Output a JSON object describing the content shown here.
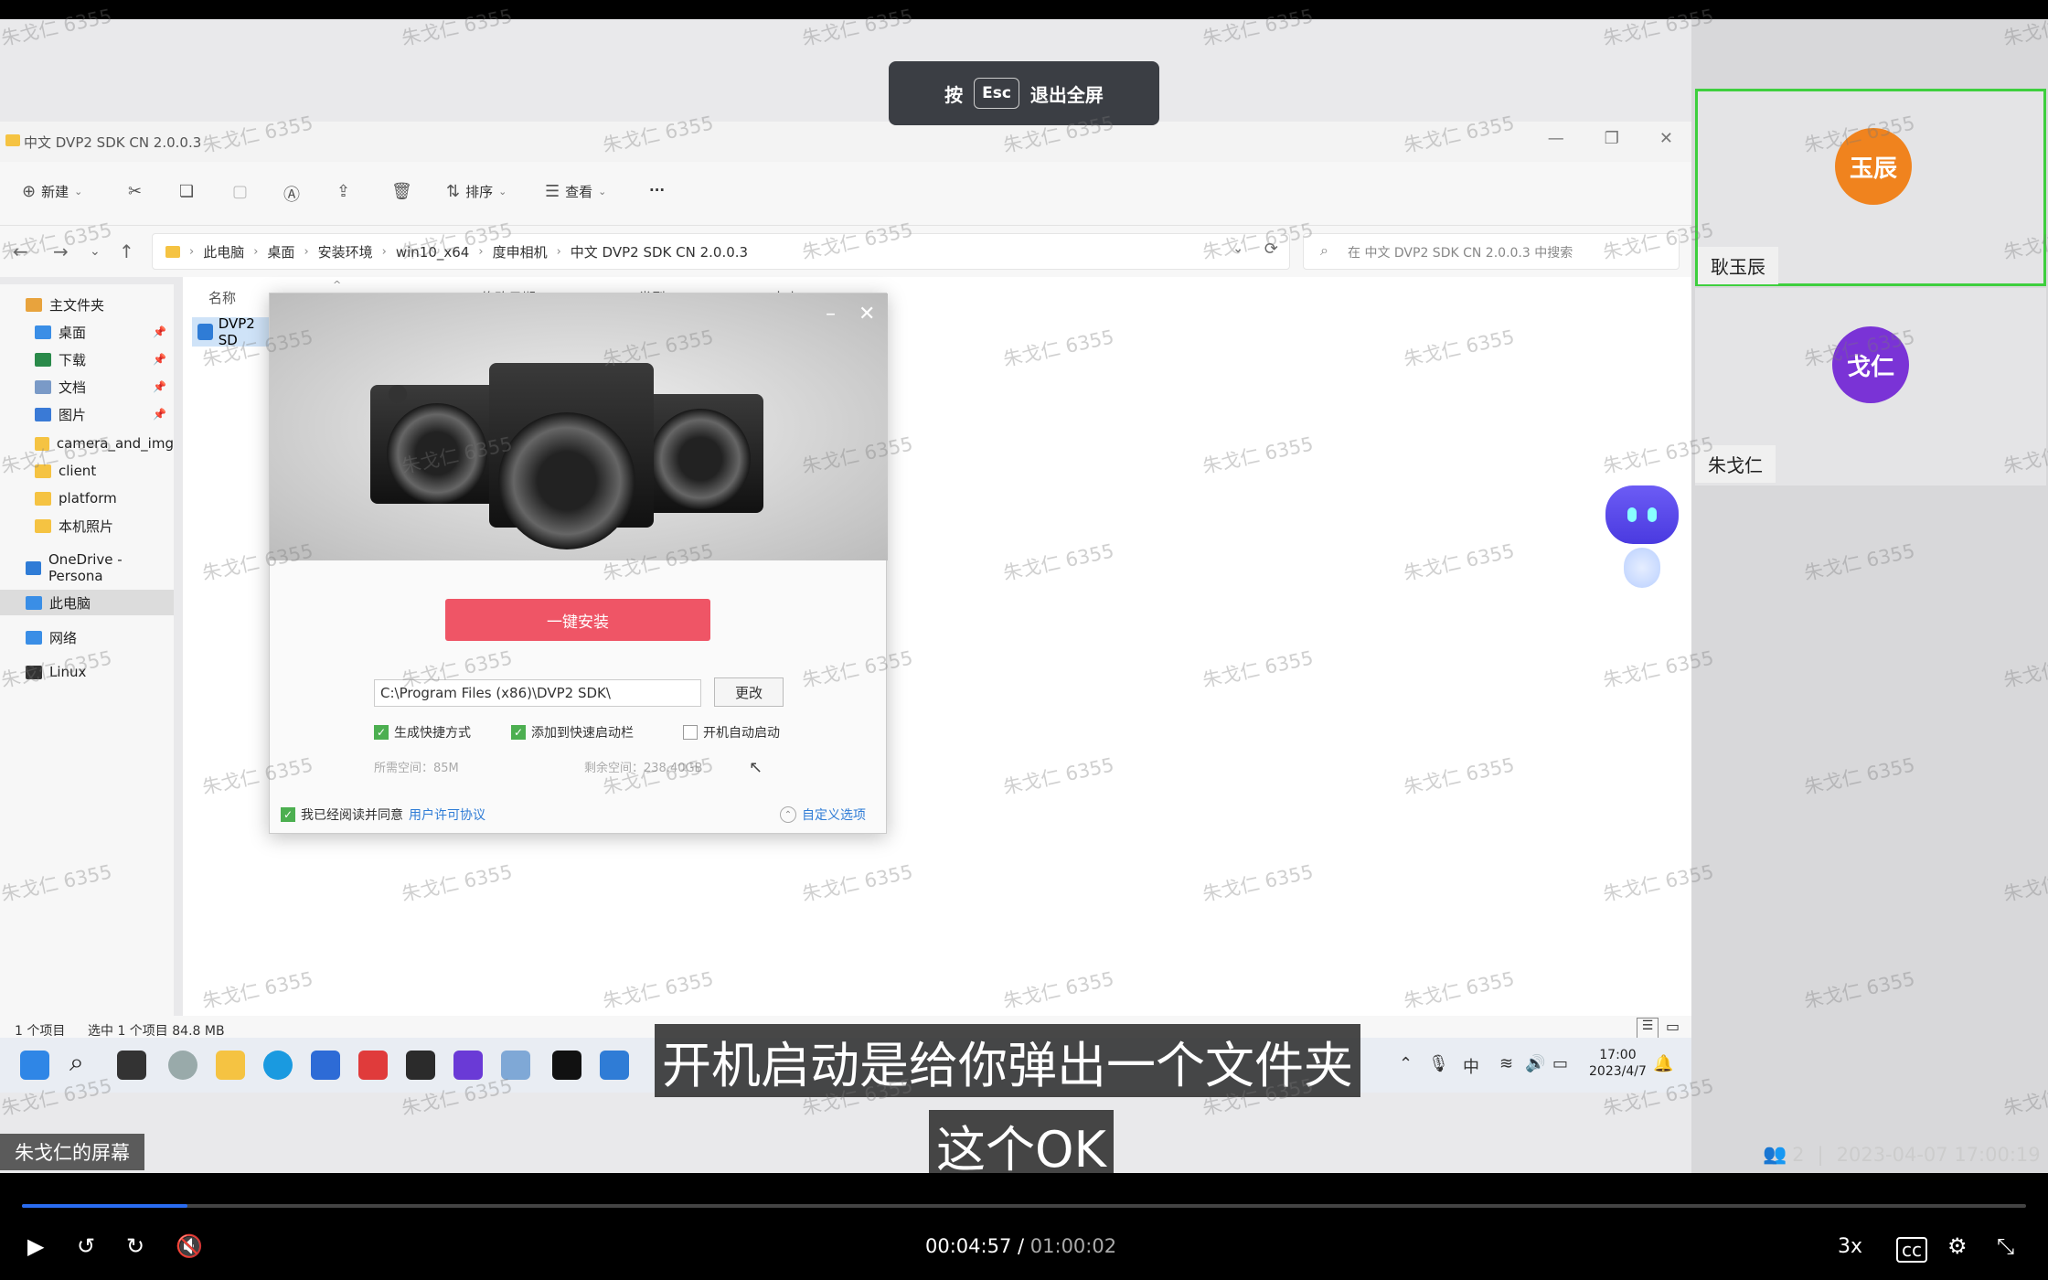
{
  "esc_hint": {
    "press": "按",
    "key": "Esc",
    "action": "退出全屏"
  },
  "explorer": {
    "title": "中文 DVP2 SDK CN 2.0.0.3",
    "toolbar": {
      "new": "新建",
      "sort": "排序",
      "view": "查看",
      "more": "···"
    },
    "breadcrumbs": [
      "此电脑",
      "桌面",
      "安装环境",
      "win10_x64",
      "度申相机",
      "中文 DVP2 SDK CN 2.0.0.3"
    ],
    "search_placeholder": "在 中文 DVP2 SDK CN 2.0.0.3 中搜索",
    "sidebar": [
      {
        "label": "主文件夹",
        "icon": "home-icon",
        "color": "#e8a33d"
      },
      {
        "label": "桌面",
        "icon": "desktop-icon",
        "color": "#3a8ee6"
      },
      {
        "label": "下载",
        "icon": "download-icon",
        "color": "#2a8a4a"
      },
      {
        "label": "文档",
        "icon": "document-icon",
        "color": "#7a9ac7"
      },
      {
        "label": "图片",
        "icon": "picture-icon",
        "color": "#3a7ad6"
      },
      {
        "label": "camera_and_img",
        "icon": "folder-icon",
        "color": "#f5c342"
      },
      {
        "label": "client",
        "icon": "folder-icon",
        "color": "#f5c342"
      },
      {
        "label": "platform",
        "icon": "folder-icon",
        "color": "#f5c342"
      },
      {
        "label": "本机照片",
        "icon": "folder-icon",
        "color": "#f5c342"
      },
      {
        "label": "OneDrive - Persona",
        "icon": "cloud-icon",
        "color": "#2f7cd6"
      },
      {
        "label": "此电脑",
        "icon": "computer-icon",
        "color": "#3a8ee6"
      },
      {
        "label": "网络",
        "icon": "network-icon",
        "color": "#3a8ee6"
      },
      {
        "label": "Linux",
        "icon": "linux-icon",
        "color": "#333333"
      }
    ],
    "columns": [
      "名称",
      "修改日期",
      "类型",
      "大小"
    ],
    "file": "DVP2 SD",
    "status": {
      "count": "1 个项目",
      "selected": "选中 1 个项目 84.8 MB"
    }
  },
  "installer": {
    "install_button": "一键安装",
    "path": "C:\\Program Files (x86)\\DVP2 SDK\\",
    "change_button": "更改",
    "options": [
      {
        "label": "生成快捷方式",
        "checked": true
      },
      {
        "label": "添加到快速启动栏",
        "checked": true
      },
      {
        "label": "开机自动启动",
        "checked": false
      }
    ],
    "required_space": "所需空间：85M",
    "free_space": "剩余空间：238.40GB",
    "agree_text": "我已经阅读并同意",
    "license_link": "用户许可协议",
    "custom_options": "自定义选项"
  },
  "taskbar": {
    "ime": "中",
    "time": "17:00",
    "date": "2023/4/7"
  },
  "participants": [
    {
      "avatar": "玉辰",
      "name": "耿玉辰",
      "color": "#f0831e"
    },
    {
      "avatar": "戈仁",
      "name": "朱戈仁",
      "color": "#7a33d6"
    }
  ],
  "subtitles": {
    "line1": "开机启动是给你弹出一个文件夹",
    "line2": "这个OK"
  },
  "screen_owner": "朱戈仁的屏幕",
  "meeting": {
    "participants": "2",
    "separator": "|",
    "datetime": "2023-04-07 17:00:19"
  },
  "player": {
    "current": "00:04:57",
    "separator": " / ",
    "duration": "01:00:02",
    "speed": "3x",
    "progress": 0.0825
  },
  "watermark": "朱戈仁 6355"
}
